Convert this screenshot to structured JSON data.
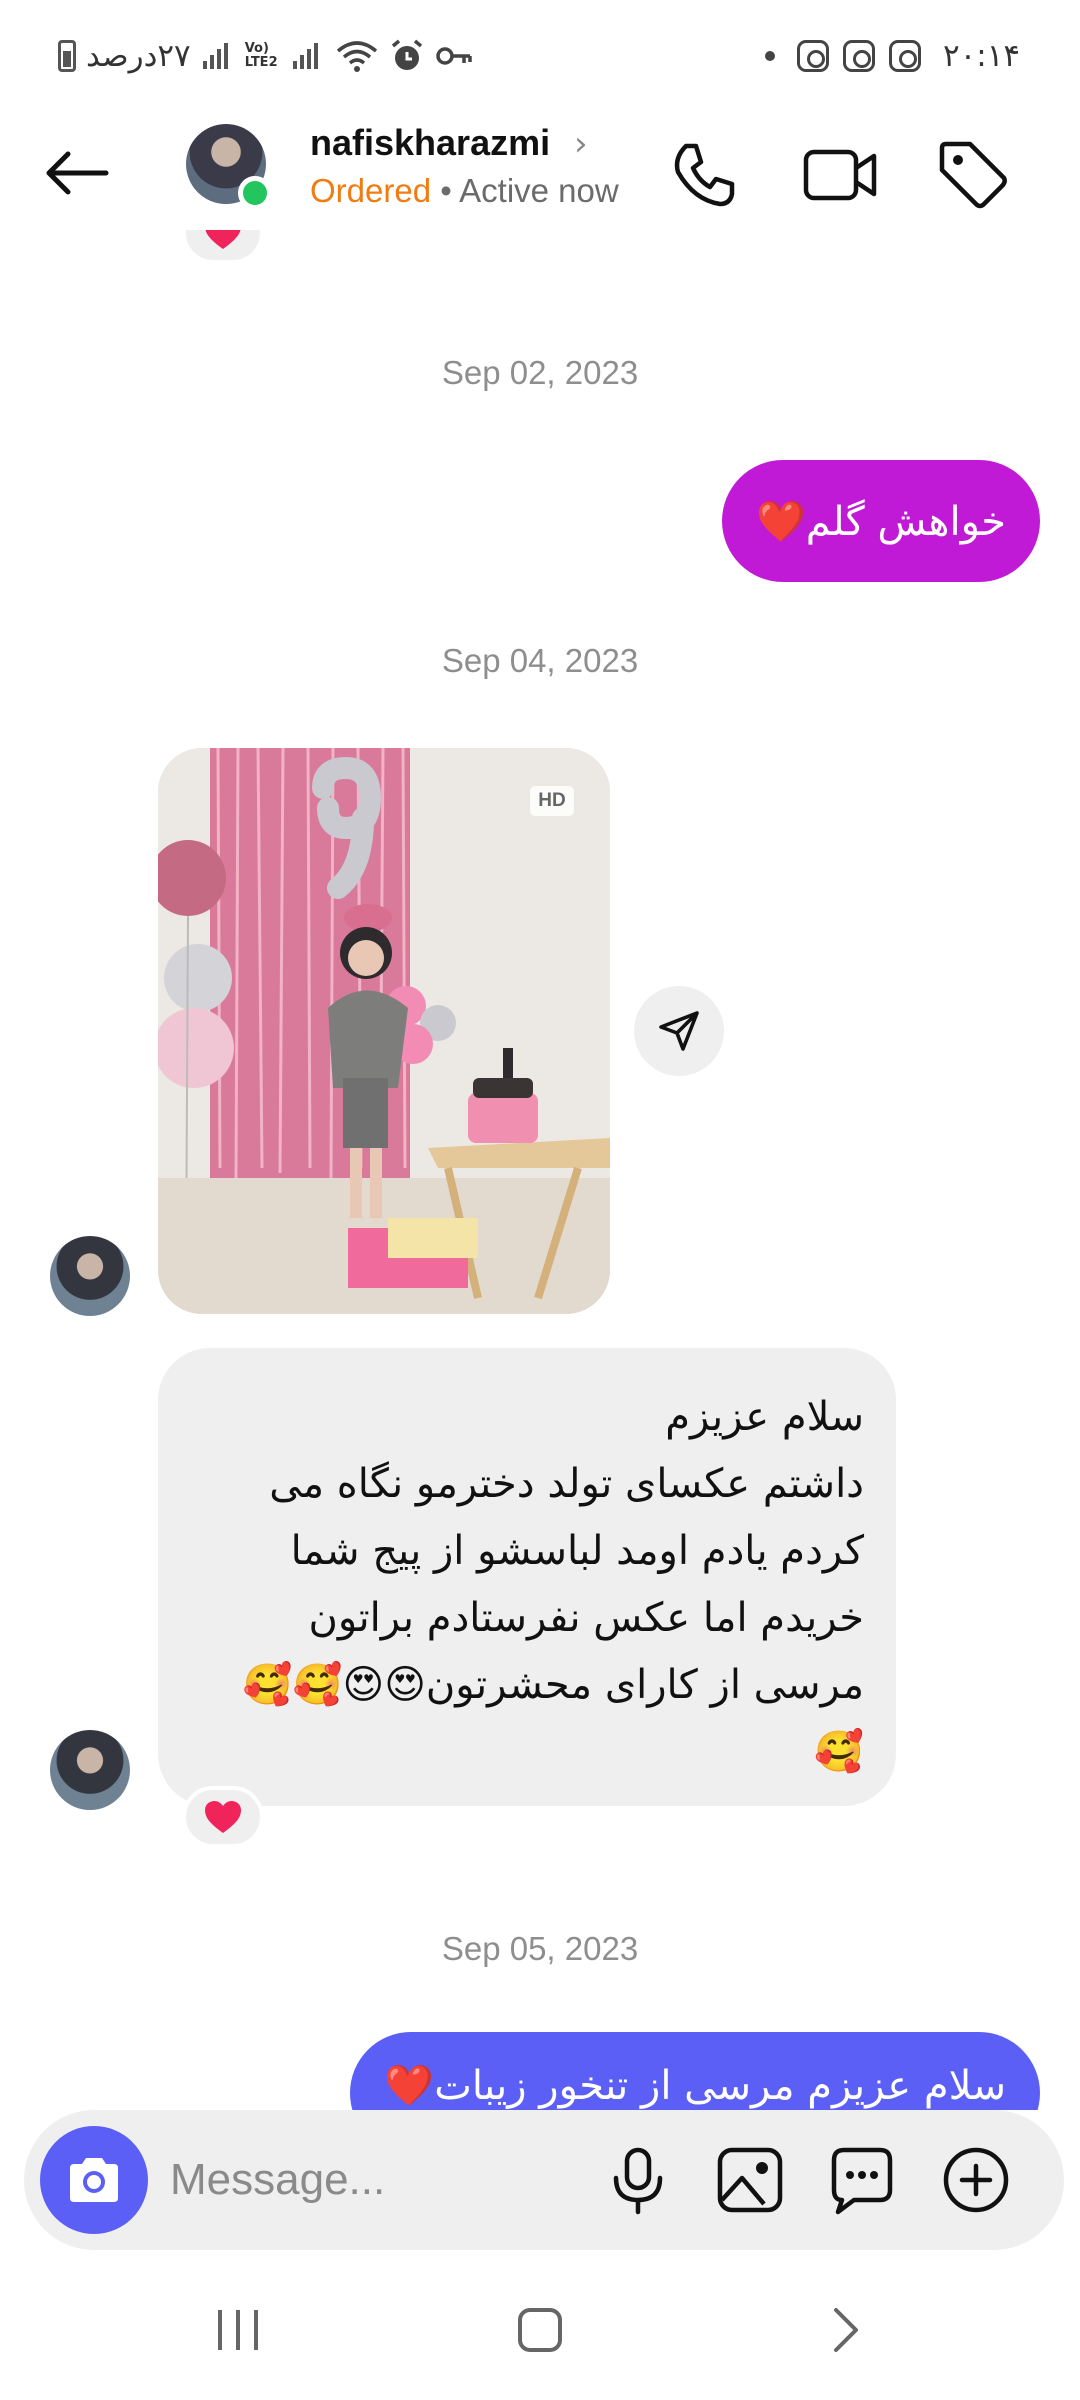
{
  "status_bar": {
    "left_text": "۲۷درصد",
    "signal_label": "Vo) LTE2",
    "time": "۲۰:۱۴"
  },
  "header": {
    "username": "nafiskharazmi",
    "order_status": "Ordered",
    "active_status": "• Active now"
  },
  "messages": {
    "date_1": "Sep 02, 2023",
    "outgoing_1": "خواهش گلم❤️",
    "date_2": "Sep 04, 2023",
    "photo_badge": "HD",
    "incoming_lines": [
      "سلام عزیزم",
      "داشتم عکسای تولد دخترمو نگاه می",
      "کردم یادم اومد لباسشو از پیج شما",
      "خریدم اما عکس نفرستادم براتون",
      "مرسی از کارای محشرتون😍😍🥰🥰",
      "🥰"
    ],
    "date_3": "Sep 05, 2023",
    "outgoing_2": "سلام عزیزم مرسی  از تنخور زیبات❤️"
  },
  "composer": {
    "placeholder": "Message..."
  },
  "colors": {
    "outgoing_purple": "#c11ad6",
    "outgoing_blue": "#5b5ff5",
    "camera_button": "#5b5ff5",
    "online_dot": "#22c55e",
    "ordered_orange": "#f07c12",
    "incoming_bubble": "#efefef"
  },
  "icons": [
    "back-arrow-icon",
    "phone-icon",
    "video-icon",
    "tag-icon",
    "send-icon",
    "camera-icon",
    "microphone-icon",
    "gallery-icon",
    "sticker-icon",
    "add-icon",
    "heart-icon"
  ]
}
